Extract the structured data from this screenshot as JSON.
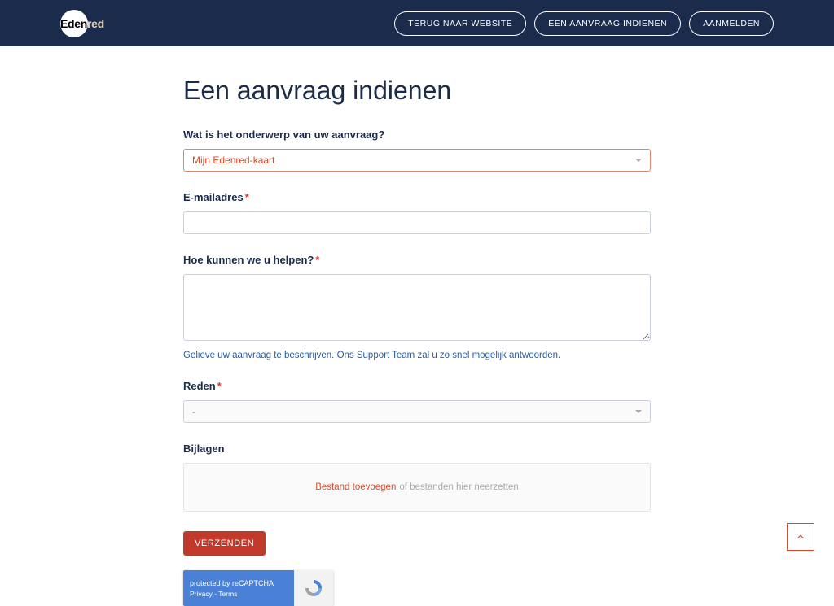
{
  "brand": "Edenred",
  "nav": {
    "back": "TERUG NAAR WEBSITE",
    "submit": "EEN AANVRAAG INDIENEN",
    "signin": "AANMELDEN"
  },
  "page": {
    "title": "Een aanvraag indienen"
  },
  "form": {
    "subject": {
      "label": "Wat is het onderwerp van uw aanvraag?",
      "selected": "Mijn Edenred-kaart"
    },
    "email": {
      "label": "E-mailadres",
      "value": ""
    },
    "help": {
      "label": "Hoe kunnen we u helpen?",
      "value": "",
      "hint": "Gelieve uw aanvraag te beschrijven. Ons Support Team zal u zo snel mogelijk antwoorden."
    },
    "reason": {
      "label": "Reden",
      "selected": "-"
    },
    "attachments": {
      "label": "Bijlagen",
      "link_text": "Bestand toevoegen",
      "rest_text": "of bestanden hier neerzetten"
    },
    "submit_label": "VERZENDEN"
  },
  "recaptcha": {
    "line1": "protected by reCAPTCHA",
    "line2": "Privacy - Terms"
  }
}
